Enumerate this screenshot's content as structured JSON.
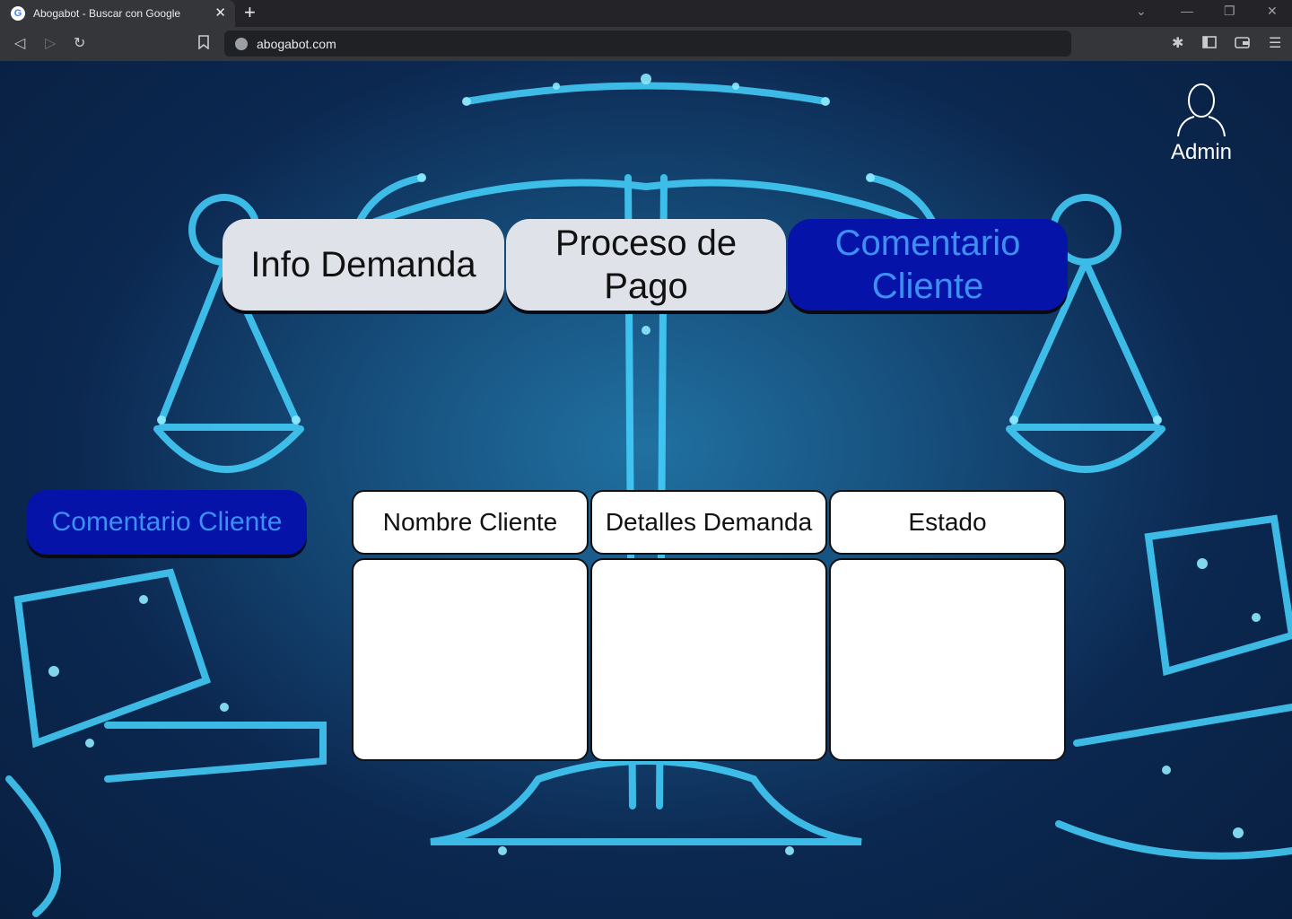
{
  "browser": {
    "tab_title": "Abogabot - Buscar con Google",
    "tab_close": "✕",
    "new_tab": "+",
    "url": "abogabot.com"
  },
  "header": {
    "admin_label": "Admin"
  },
  "nav": {
    "tabs": [
      {
        "label": "Info Demanda",
        "active": false
      },
      {
        "label": "Proceso de Pago",
        "active": false
      },
      {
        "label": "Comentario Cliente",
        "active": true
      }
    ]
  },
  "sidebar": {
    "button_label": "Comentario Cliente"
  },
  "table": {
    "headers": [
      "Nombre Cliente",
      "Detalles Demanda",
      "Estado"
    ],
    "rows": [
      [
        "",
        "",
        ""
      ]
    ]
  },
  "colors": {
    "accent_button": "#0613a8",
    "accent_text": "#3d8ff2",
    "light_button": "#dfe2e9",
    "background": "#0d2c58",
    "glow": "#3ad6ff"
  }
}
